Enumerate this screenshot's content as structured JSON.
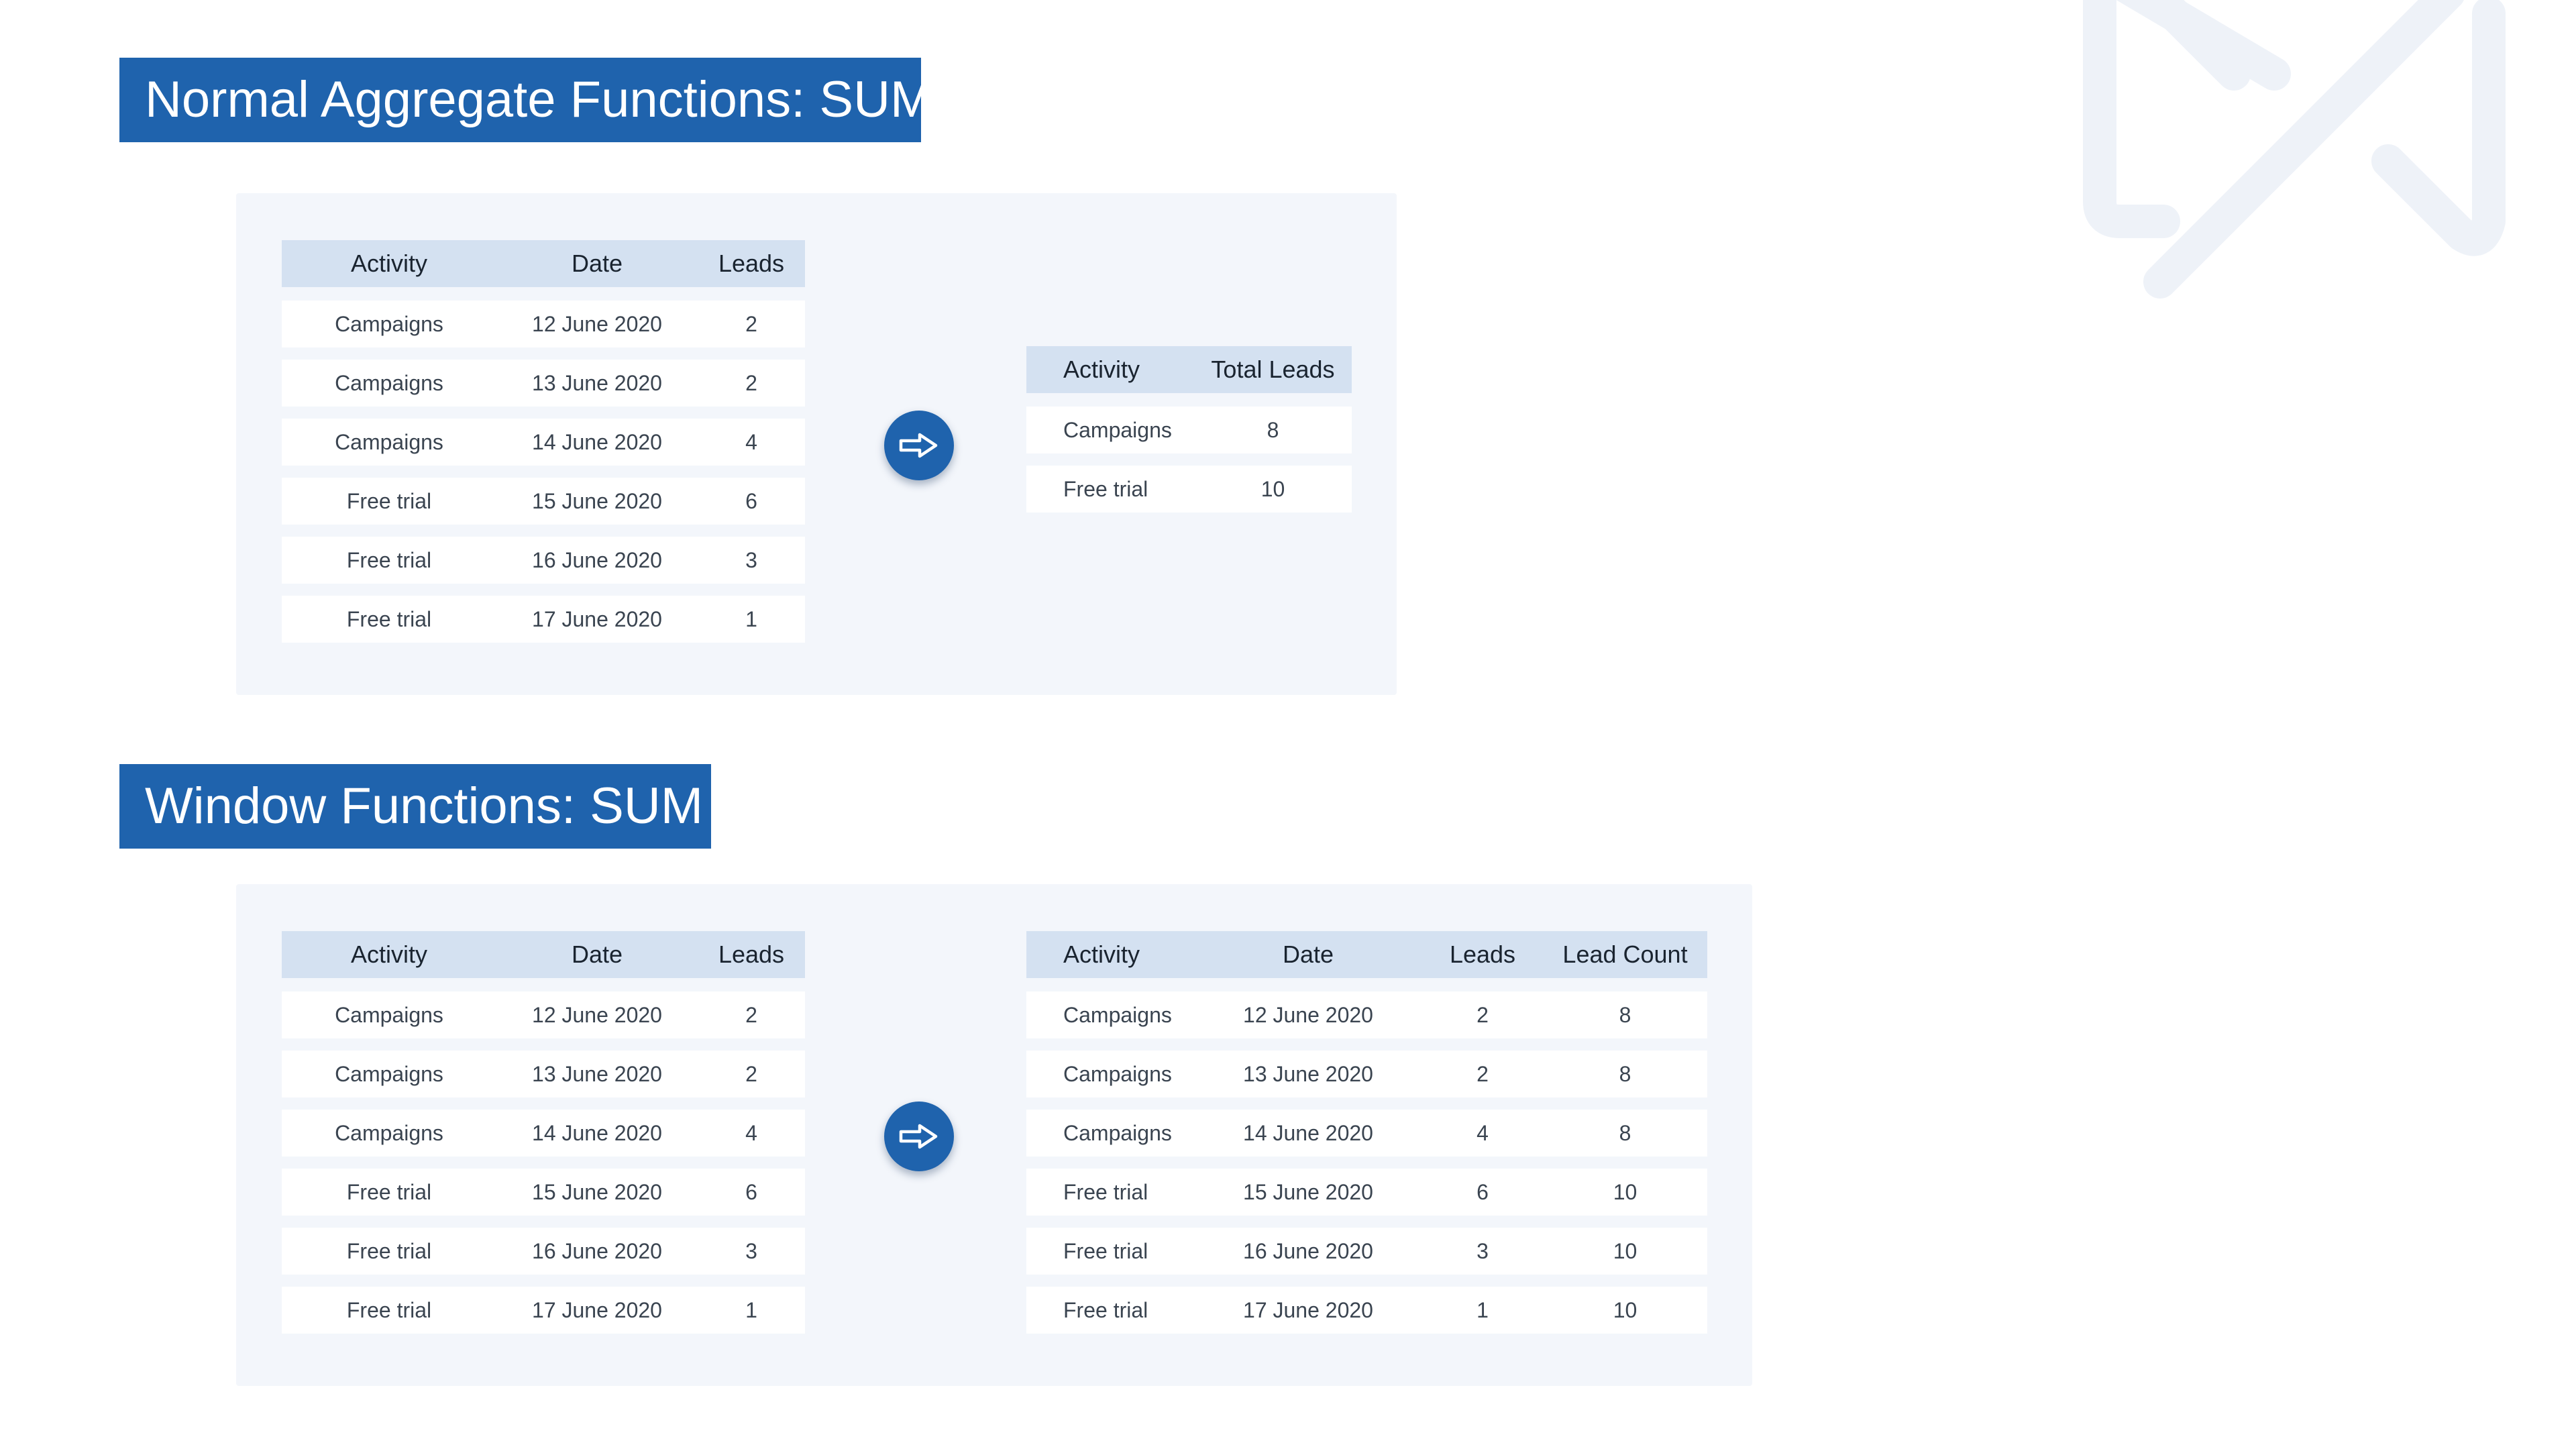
{
  "colors": {
    "accent": "#1f63ad",
    "panel": "#f3f6fb",
    "table_header": "#d4e1f1",
    "logo": "#eef2f8"
  },
  "icons": {
    "arrow": "right-arrow-icon",
    "logo": "brand-logo-icon"
  },
  "aggregate": {
    "title": "Normal Aggregate Functions: SUM",
    "input": {
      "headers": [
        "Activity",
        "Date",
        "Leads"
      ],
      "rows": [
        [
          "Campaigns",
          "12 June 2020",
          "2"
        ],
        [
          "Campaigns",
          "13 June 2020",
          "2"
        ],
        [
          "Campaigns",
          "14 June 2020",
          "4"
        ],
        [
          "Free trial",
          "15 June 2020",
          "6"
        ],
        [
          "Free trial",
          "16 June 2020",
          "3"
        ],
        [
          "Free trial",
          "17 June 2020",
          "1"
        ]
      ]
    },
    "output": {
      "headers": [
        "Activity",
        "Total Leads"
      ],
      "rows": [
        [
          "Campaigns",
          "8"
        ],
        [
          "Free trial",
          "10"
        ]
      ]
    }
  },
  "window": {
    "title": "Window Functions: SUM",
    "input": {
      "headers": [
        "Activity",
        "Date",
        "Leads"
      ],
      "rows": [
        [
          "Campaigns",
          "12 June 2020",
          "2"
        ],
        [
          "Campaigns",
          "13 June 2020",
          "2"
        ],
        [
          "Campaigns",
          "14 June 2020",
          "4"
        ],
        [
          "Free trial",
          "15 June 2020",
          "6"
        ],
        [
          "Free trial",
          "16 June 2020",
          "3"
        ],
        [
          "Free trial",
          "17 June 2020",
          "1"
        ]
      ]
    },
    "output": {
      "headers": [
        "Activity",
        "Date",
        "Leads",
        "Lead Count"
      ],
      "rows": [
        [
          "Campaigns",
          "12 June 2020",
          "2",
          "8"
        ],
        [
          "Campaigns",
          "13 June 2020",
          "2",
          "8"
        ],
        [
          "Campaigns",
          "14 June 2020",
          "4",
          "8"
        ],
        [
          "Free trial",
          "15 June 2020",
          "6",
          "10"
        ],
        [
          "Free trial",
          "16 June 2020",
          "3",
          "10"
        ],
        [
          "Free trial",
          "17 June 2020",
          "1",
          "10"
        ]
      ]
    }
  }
}
